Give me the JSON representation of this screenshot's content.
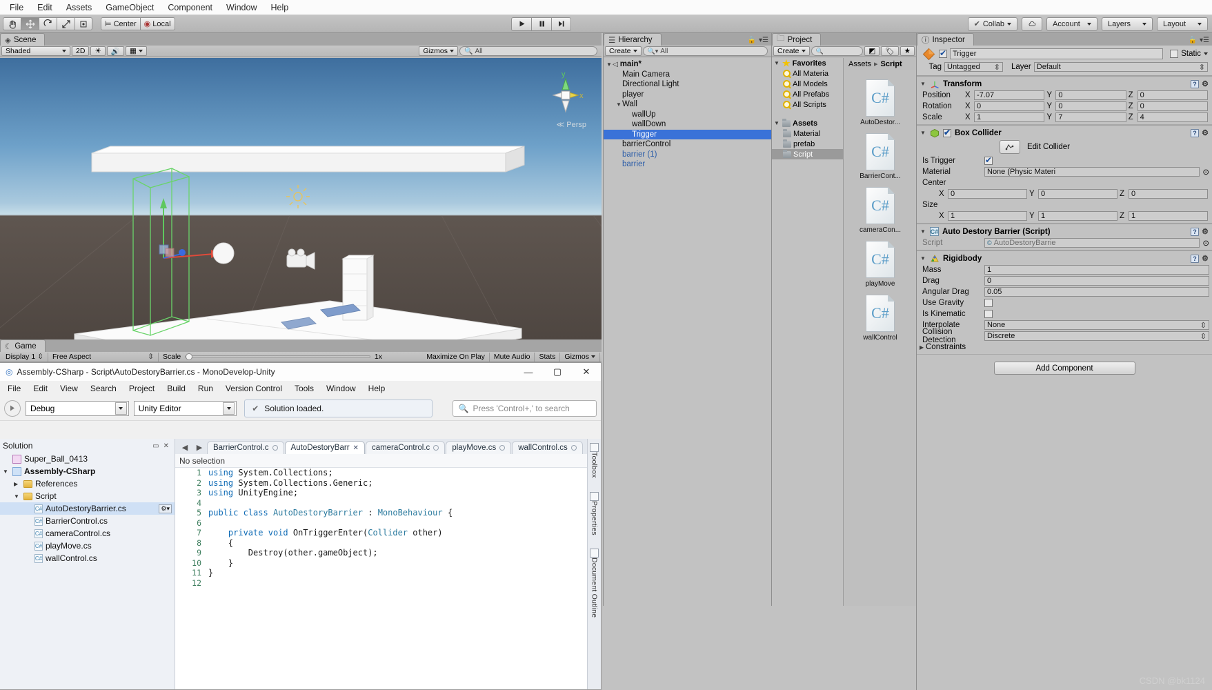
{
  "unity": {
    "menu": [
      "File",
      "Edit",
      "Assets",
      "GameObject",
      "Component",
      "Window",
      "Help"
    ],
    "toolbar": {
      "transform_tools": [
        "hand-tool",
        "move-tool",
        "rotate-tool",
        "scale-tool",
        "rect-tool"
      ],
      "pivot_mode": "Center",
      "pivot_rotation": "Local",
      "play": "play-icon",
      "pause": "pause-icon",
      "step": "step-icon",
      "collab": "Collab",
      "cloud": "cloud-icon",
      "account": "Account",
      "layers": "Layers",
      "layout": "Layout"
    },
    "scene": {
      "tab": "Scene",
      "shading": "Shaded",
      "mode_2d": "2D",
      "gizmos": "Gizmos",
      "search_placeholder": "All",
      "persp_label": "Persp",
      "axis_x": "x",
      "axis_y": "y"
    },
    "game": {
      "tab": "Game",
      "display": "Display 1",
      "aspect": "Free Aspect",
      "scale_label": "Scale",
      "scale_value": "1x",
      "maximize": "Maximize On Play",
      "mute": "Mute Audio",
      "stats": "Stats",
      "gizmos": "Gizmos"
    },
    "hierarchy": {
      "tab": "Hierarchy",
      "create": "Create",
      "search_placeholder": "All",
      "items": [
        {
          "label": "main*",
          "depth": 0,
          "expand": "down",
          "bold": true,
          "selected": false,
          "prefab": false
        },
        {
          "label": "Main Camera",
          "depth": 1,
          "expand": "none",
          "bold": false,
          "selected": false,
          "prefab": false
        },
        {
          "label": "Directional Light",
          "depth": 1,
          "expand": "none",
          "bold": false,
          "selected": false,
          "prefab": false
        },
        {
          "label": "player",
          "depth": 1,
          "expand": "none",
          "bold": false,
          "selected": false,
          "prefab": false
        },
        {
          "label": "Wall",
          "depth": 1,
          "expand": "down",
          "bold": false,
          "selected": false,
          "prefab": false
        },
        {
          "label": "wallUp",
          "depth": 2,
          "expand": "none",
          "bold": false,
          "selected": false,
          "prefab": false
        },
        {
          "label": "wallDown",
          "depth": 2,
          "expand": "none",
          "bold": false,
          "selected": false,
          "prefab": false
        },
        {
          "label": "Trigger",
          "depth": 2,
          "expand": "none",
          "bold": false,
          "selected": true,
          "prefab": false
        },
        {
          "label": "barrierControl",
          "depth": 1,
          "expand": "none",
          "bold": false,
          "selected": false,
          "prefab": false
        },
        {
          "label": "barrier (1)",
          "depth": 1,
          "expand": "none",
          "bold": false,
          "selected": false,
          "prefab": true
        },
        {
          "label": "barrier",
          "depth": 1,
          "expand": "none",
          "bold": false,
          "selected": false,
          "prefab": true
        }
      ]
    },
    "project": {
      "tab": "Project",
      "create": "Create",
      "search_placeholder": "",
      "breadcrumb": [
        "Assets",
        "Script"
      ],
      "tree": [
        {
          "label": "Favorites",
          "icon": "star",
          "depth": 0,
          "bold": true,
          "selected": false
        },
        {
          "label": "All Materia",
          "icon": "search",
          "depth": 1,
          "bold": false,
          "selected": false
        },
        {
          "label": "All Models",
          "icon": "search",
          "depth": 1,
          "bold": false,
          "selected": false
        },
        {
          "label": "All Prefabs",
          "icon": "search",
          "depth": 1,
          "bold": false,
          "selected": false
        },
        {
          "label": "All Scripts",
          "icon": "search",
          "depth": 1,
          "bold": false,
          "selected": false
        },
        {
          "label": "Assets",
          "icon": "folder",
          "depth": 0,
          "bold": true,
          "selected": false
        },
        {
          "label": "Material",
          "icon": "folder",
          "depth": 1,
          "bold": false,
          "selected": false
        },
        {
          "label": "prefab",
          "icon": "folder",
          "depth": 1,
          "bold": false,
          "selected": false
        },
        {
          "label": "Script",
          "icon": "folder",
          "depth": 1,
          "bold": false,
          "selected": true
        }
      ],
      "assets": [
        {
          "label": "AutoDestor...",
          "icon": "csharp-script-icon"
        },
        {
          "label": "BarrierCont...",
          "icon": "csharp-script-icon"
        },
        {
          "label": "cameraCon...",
          "icon": "csharp-script-icon"
        },
        {
          "label": "playMove",
          "icon": "csharp-script-icon"
        },
        {
          "label": "wallControl",
          "icon": "csharp-script-icon"
        }
      ]
    },
    "inspector": {
      "tab": "Inspector",
      "object_name": "Trigger",
      "object_enabled": true,
      "static_label": "Static",
      "static_checked": false,
      "tag_label": "Tag",
      "tag_value": "Untagged",
      "layer_label": "Layer",
      "layer_value": "Default",
      "transform": {
        "title": "Transform",
        "rows": [
          {
            "label": "Position",
            "x": "-7.07",
            "y": "0",
            "z": "0"
          },
          {
            "label": "Rotation",
            "x": "0",
            "y": "0",
            "z": "0"
          },
          {
            "label": "Scale",
            "x": "1",
            "y": "7",
            "z": "4"
          }
        ]
      },
      "box_collider": {
        "title": "Box Collider",
        "enabled": true,
        "edit_collider": "Edit Collider",
        "is_trigger_label": "Is Trigger",
        "is_trigger": true,
        "material_label": "Material",
        "material_value": "None (Physic Materi",
        "center_label": "Center",
        "center": {
          "x": "0",
          "y": "0",
          "z": "0"
        },
        "size_label": "Size",
        "size": {
          "x": "1",
          "y": "1",
          "z": "1"
        }
      },
      "script_component": {
        "title": "Auto Destory Barrier (Script)",
        "script_label": "Script",
        "script_value": "AutoDestoryBarrie"
      },
      "rigidbody": {
        "title": "Rigidbody",
        "mass_label": "Mass",
        "mass": "1",
        "drag_label": "Drag",
        "drag": "0",
        "angular_drag_label": "Angular Drag",
        "angular_drag": "0.05",
        "use_gravity_label": "Use Gravity",
        "use_gravity": false,
        "is_kinematic_label": "Is Kinematic",
        "is_kinematic": false,
        "interpolate_label": "Interpolate",
        "interpolate": "None",
        "collision_detection_label": "Collision Detection",
        "collision_detection": "Discrete",
        "constraints_label": "Constraints"
      },
      "add_component": "Add Component"
    }
  },
  "monodevelop": {
    "title": "Assembly-CSharp - Script\\AutoDestoryBarrier.cs - MonoDevelop-Unity",
    "window_buttons": {
      "minimize": "—",
      "maximize": "▢",
      "close": "✕"
    },
    "menu": [
      "File",
      "Edit",
      "View",
      "Search",
      "Project",
      "Build",
      "Run",
      "Version Control",
      "Tools",
      "Window",
      "Help"
    ],
    "toolbar": {
      "run_icon": "play-icon",
      "configuration": "Debug",
      "target": "Unity Editor",
      "status": "Solution loaded.",
      "search_placeholder": "Press 'Control+,' to search"
    },
    "solution": {
      "pad_title": "Solution",
      "items": [
        {
          "label": "Super_Ball_0413",
          "depth": 0,
          "icon": "solution-icon",
          "expand": "none",
          "bold": false,
          "selected": false
        },
        {
          "label": "Assembly-CSharp",
          "depth": 0,
          "icon": "project-icon",
          "expand": "down",
          "bold": true,
          "selected": false
        },
        {
          "label": "References",
          "depth": 1,
          "icon": "references-icon",
          "expand": "right",
          "bold": false,
          "selected": false
        },
        {
          "label": "Script",
          "depth": 1,
          "icon": "folder-icon",
          "expand": "down",
          "bold": false,
          "selected": false
        },
        {
          "label": "AutoDestoryBarrier.cs",
          "depth": 2,
          "icon": "csharp-file-icon",
          "expand": "none",
          "bold": false,
          "selected": true
        },
        {
          "label": "BarrierControl.cs",
          "depth": 2,
          "icon": "csharp-file-icon",
          "expand": "none",
          "bold": false,
          "selected": false
        },
        {
          "label": "cameraControl.cs",
          "depth": 2,
          "icon": "csharp-file-icon",
          "expand": "none",
          "bold": false,
          "selected": false
        },
        {
          "label": "playMove.cs",
          "depth": 2,
          "icon": "csharp-file-icon",
          "expand": "none",
          "bold": false,
          "selected": false
        },
        {
          "label": "wallControl.cs",
          "depth": 2,
          "icon": "csharp-file-icon",
          "expand": "none",
          "bold": false,
          "selected": false
        }
      ]
    },
    "editor": {
      "tabs": [
        {
          "label": "BarrierControl.c",
          "active": false,
          "modified": false
        },
        {
          "label": "AutoDestoryBarr",
          "active": true,
          "modified": false
        },
        {
          "label": "cameraControl.c",
          "active": false,
          "modified": false
        },
        {
          "label": "playMove.cs",
          "active": false,
          "modified": false
        },
        {
          "label": "wallControl.cs",
          "active": false,
          "modified": false
        }
      ],
      "selection_status": "No selection",
      "code_lines": [
        {
          "n": "1",
          "tokens": [
            {
              "t": "using",
              "c": "kw"
            },
            {
              "t": " System.Collections;",
              "c": "pl"
            }
          ]
        },
        {
          "n": "2",
          "tokens": [
            {
              "t": "using",
              "c": "kw"
            },
            {
              "t": " System.Collections.Generic;",
              "c": "pl"
            }
          ]
        },
        {
          "n": "3",
          "tokens": [
            {
              "t": "using",
              "c": "kw"
            },
            {
              "t": " UnityEngine;",
              "c": "pl"
            }
          ]
        },
        {
          "n": "4",
          "tokens": []
        },
        {
          "n": "5",
          "tokens": [
            {
              "t": "public",
              "c": "kw"
            },
            {
              "t": " ",
              "c": "pl"
            },
            {
              "t": "class",
              "c": "kw"
            },
            {
              "t": " ",
              "c": "pl"
            },
            {
              "t": "AutoDestoryBarrier",
              "c": "ty"
            },
            {
              "t": " : ",
              "c": "pl"
            },
            {
              "t": "MonoBehaviour",
              "c": "ty"
            },
            {
              "t": " {",
              "c": "pl"
            }
          ]
        },
        {
          "n": "6",
          "tokens": []
        },
        {
          "n": "7",
          "tokens": [
            {
              "t": "    ",
              "c": "pl"
            },
            {
              "t": "private",
              "c": "kw"
            },
            {
              "t": " ",
              "c": "pl"
            },
            {
              "t": "void",
              "c": "kw"
            },
            {
              "t": " OnTriggerEnter(",
              "c": "pl"
            },
            {
              "t": "Collider",
              "c": "ty"
            },
            {
              "t": " other)",
              "c": "pl"
            }
          ]
        },
        {
          "n": "8",
          "tokens": [
            {
              "t": "    {",
              "c": "pl"
            }
          ]
        },
        {
          "n": "9",
          "tokens": [
            {
              "t": "        Destroy(other.gameObject);",
              "c": "pl"
            }
          ]
        },
        {
          "n": "10",
          "tokens": [
            {
              "t": "    }",
              "c": "pl"
            }
          ]
        },
        {
          "n": "11",
          "tokens": [
            {
              "t": "}",
              "c": "pl"
            }
          ]
        },
        {
          "n": "12",
          "tokens": []
        }
      ]
    },
    "right_pads": [
      "Toolbox",
      "Properties",
      "Document Outline"
    ]
  },
  "watermark": "CSDN @bk1124",
  "colors": {
    "selection_blue": "#3a72d8",
    "unity_gray": "#c2c2c2",
    "prefab_blue": "#2a5ca8",
    "accent_csharp": "#5b9dc8"
  }
}
